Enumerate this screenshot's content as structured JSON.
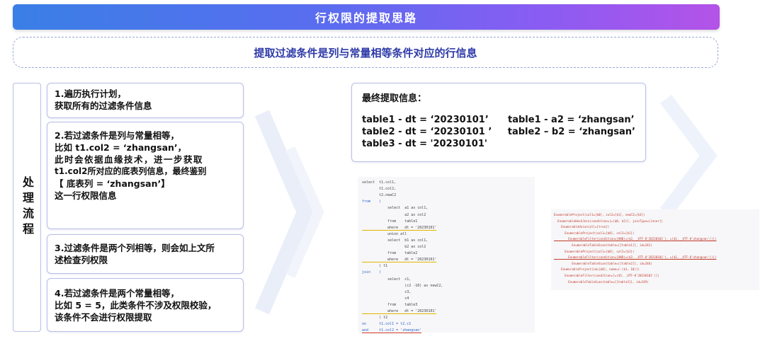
{
  "title": "行权限的提取思路",
  "subtitle": "提取过滤条件是列与常量相等条件对应的行信息",
  "process_label": "处理流程",
  "steps": [
    {
      "lines": [
        "1.遍历执行计划，",
        "获取所有的过滤条件信息"
      ]
    },
    {
      "lines": [
        "2.若过滤条件是列与常量相等，",
        "比如 t1.col2 = ‘zhangsan’，",
        "此时会依据血缘技术，进一步获取",
        "t1.col2所对应的底表列信息，最终鉴别",
        "【 底表列 = ‘zhangsan’】",
        "这一行权限信息"
      ]
    },
    {
      "lines": [
        "3.过滤条件是两个列相等，则会如上文所",
        "述检查列权限"
      ]
    },
    {
      "lines": [
        "4.若过滤条件是两个常量相等，",
        "比如 5 = 5，此类条件不涉及权限校验，",
        "该条件不会进行权限提取"
      ]
    }
  ],
  "final": {
    "heading": "最终提取信息：",
    "rows": [
      [
        "table1 - dt = ‘20230101’",
        "table1 - a2 = ‘zhangsan’"
      ],
      [
        "table2 - dt = ‘20230101 ’",
        "table2 – b2 = ‘zhangsan’"
      ],
      [
        "table3 - dt = '20230101'",
        ""
      ]
    ]
  },
  "sql": [
    "select  t1.col1,",
    "        t1.col2,",
    "        t2.newC2",
    "from    (",
    "            select  a1 as col1,",
    "                    a2 as col2",
    "            from    table1",
    "            where   dt = '20230101'",
    "            union all",
    "            select  b1 as col1,",
    "                    b2 as col2",
    "            from    table2",
    "            where   dt = '20230101'",
    "        ) t1",
    "join    (",
    "            select  c1,",
    "                    (c2 -10) as newC2,",
    "                    c3,",
    "                    c4",
    "            from    table3",
    "            where   dt = '20230101'",
    "        ) t2",
    "on      t1.col1 = t2.c1",
    "and     t1.col2 = 'zhangsan'"
  ],
  "plan": [
    "EnumerableProject(col1=[$0], col2=[$1], newC2=[$3])",
    "  EnumerableHashJoin(condition=[=($0, $2)], joinType=[inner])",
    "    EnumerableUnion(all=[true])",
    "      EnumerableProject(col1=[$0], col2=[$1])",
    "        EnumerableFilter(condition=[AND(=($2, _UTF-8'20230101'), =($1, _UTF-8'zhangsan'))])",
    "          EnumerableTableScan(table=[[table1]], id=242)",
    "      EnumerableProject(col1=[$0], col2=[$1])",
    "        EnumerableFilter(condition=[AND(=($2, _UTF-8'20230101'), =($1, _UTF-8'zhangsan'))])",
    "          EnumerableTableScan(table=[[table2]], id=246)",
    "    EnumerableProject(id=[$0], name=[-($1, 10)])",
    "      EnumerableFilter(condition=[=($5, _UTF-8'20230101')])",
    "        EnumerableTableScan(table=[[table3]], id=249)"
  ]
}
